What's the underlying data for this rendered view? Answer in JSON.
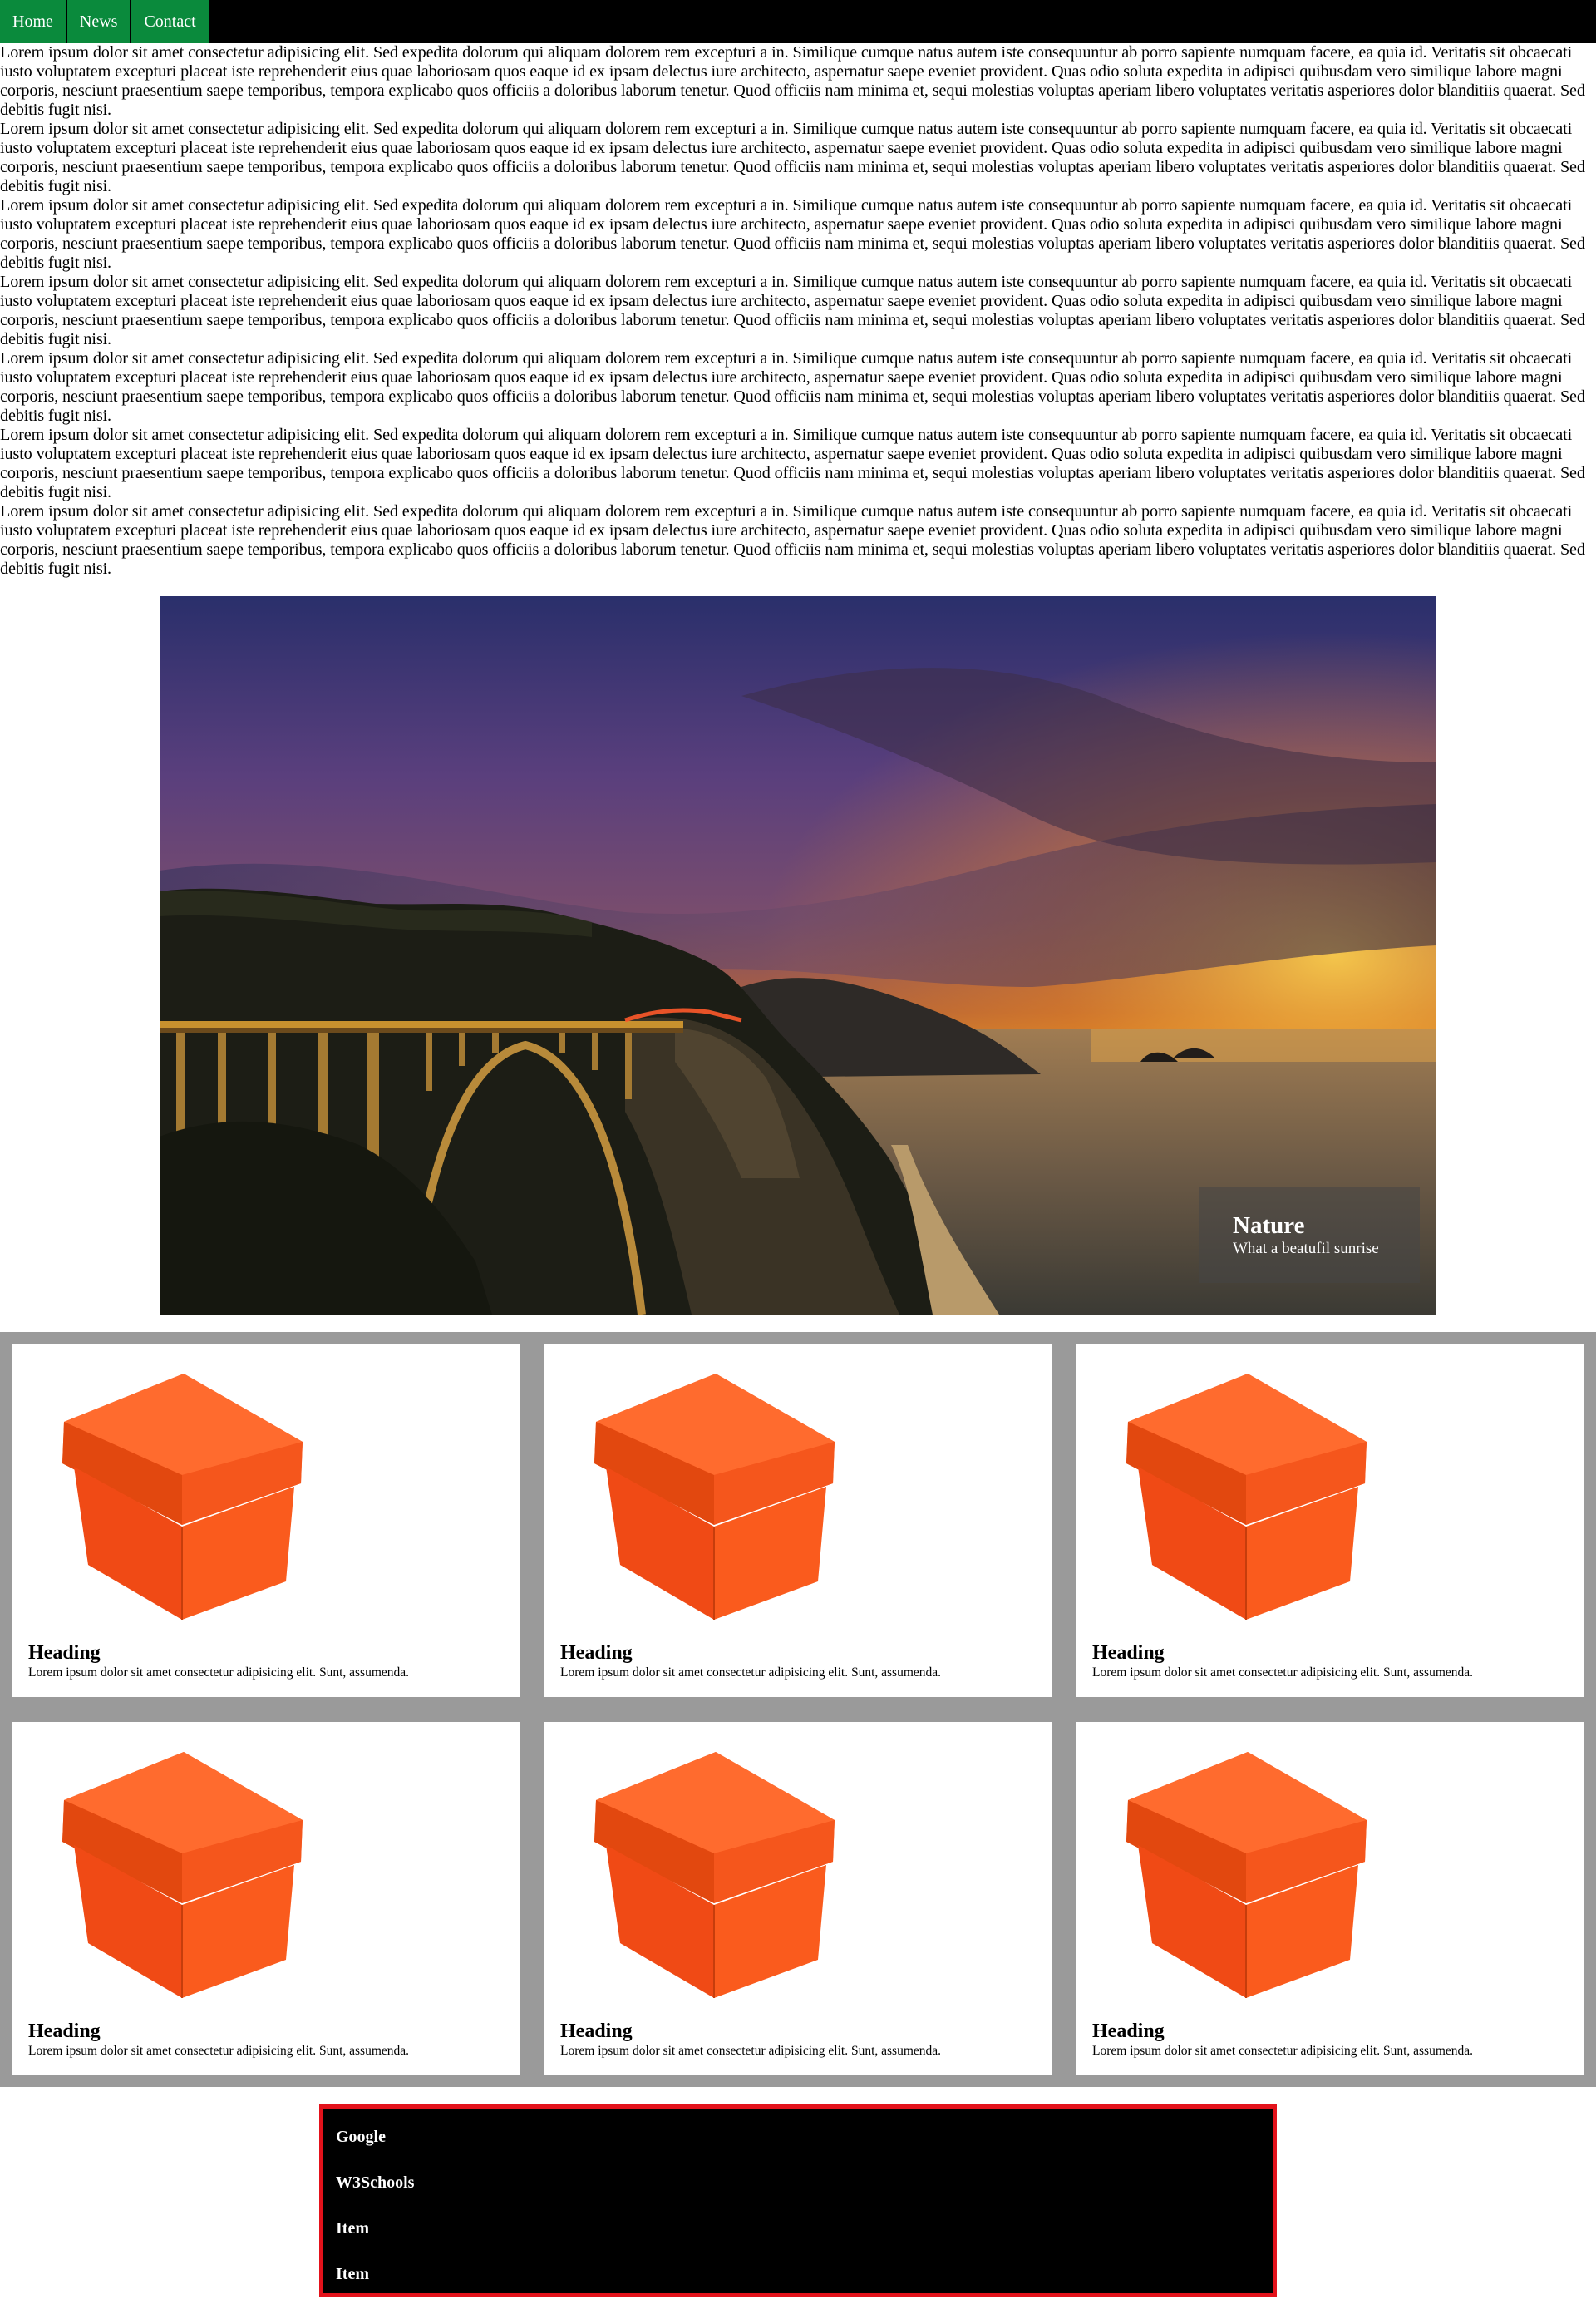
{
  "nav": {
    "items": [
      {
        "label": "Home"
      },
      {
        "label": "News"
      },
      {
        "label": "Contact"
      }
    ]
  },
  "paragraphs": [
    "Lorem ipsum dolor sit amet consectetur adipisicing elit. Sed expedita dolorum qui aliquam dolorem rem excepturi a in. Similique cumque natus autem iste consequuntur ab porro sapiente numquam facere, ea quia id. Veritatis sit obcaecati iusto voluptatem excepturi placeat iste reprehenderit eius quae laboriosam quos eaque id ex ipsam delectus iure architecto, aspernatur saepe eveniet provident. Quas odio soluta expedita in adipisci quibusdam vero similique labore magni corporis, nesciunt praesentium saepe temporibus, tempora explicabo quos officiis a doloribus laborum tenetur. Quod officiis nam minima et, sequi molestias voluptas aperiam libero voluptates veritatis asperiores dolor blanditiis quaerat. Sed debitis fugit nisi.",
    "Lorem ipsum dolor sit amet consectetur adipisicing elit. Sed expedita dolorum qui aliquam dolorem rem excepturi a in. Similique cumque natus autem iste consequuntur ab porro sapiente numquam facere, ea quia id. Veritatis sit obcaecati iusto voluptatem excepturi placeat iste reprehenderit eius quae laboriosam quos eaque id ex ipsam delectus iure architecto, aspernatur saepe eveniet provident. Quas odio soluta expedita in adipisci quibusdam vero similique labore magni corporis, nesciunt praesentium saepe temporibus, tempora explicabo quos officiis a doloribus laborum tenetur. Quod officiis nam minima et, sequi molestias voluptas aperiam libero voluptates veritatis asperiores dolor blanditiis quaerat. Sed debitis fugit nisi.",
    "Lorem ipsum dolor sit amet consectetur adipisicing elit. Sed expedita dolorum qui aliquam dolorem rem excepturi a in. Similique cumque natus autem iste consequuntur ab porro sapiente numquam facere, ea quia id. Veritatis sit obcaecati iusto voluptatem excepturi placeat iste reprehenderit eius quae laboriosam quos eaque id ex ipsam delectus iure architecto, aspernatur saepe eveniet provident. Quas odio soluta expedita in adipisci quibusdam vero similique labore magni corporis, nesciunt praesentium saepe temporibus, tempora explicabo quos officiis a doloribus laborum tenetur. Quod officiis nam minima et, sequi molestias voluptas aperiam libero voluptates veritatis asperiores dolor blanditiis quaerat. Sed debitis fugit nisi.",
    "Lorem ipsum dolor sit amet consectetur adipisicing elit. Sed expedita dolorum qui aliquam dolorem rem excepturi a in. Similique cumque natus autem iste consequuntur ab porro sapiente numquam facere, ea quia id. Veritatis sit obcaecati iusto voluptatem excepturi placeat iste reprehenderit eius quae laboriosam quos eaque id ex ipsam delectus iure architecto, aspernatur saepe eveniet provident. Quas odio soluta expedita in adipisci quibusdam vero similique labore magni corporis, nesciunt praesentium saepe temporibus, tempora explicabo quos officiis a doloribus laborum tenetur. Quod officiis nam minima et, sequi molestias voluptas aperiam libero voluptates veritatis asperiores dolor blanditiis quaerat. Sed debitis fugit nisi.",
    "Lorem ipsum dolor sit amet consectetur adipisicing elit. Sed expedita dolorum qui aliquam dolorem rem excepturi a in. Similique cumque natus autem iste consequuntur ab porro sapiente numquam facere, ea quia id. Veritatis sit obcaecati iusto voluptatem excepturi placeat iste reprehenderit eius quae laboriosam quos eaque id ex ipsam delectus iure architecto, aspernatur saepe eveniet provident. Quas odio soluta expedita in adipisci quibusdam vero similique labore magni corporis, nesciunt praesentium saepe temporibus, tempora explicabo quos officiis a doloribus laborum tenetur. Quod officiis nam minima et, sequi molestias voluptas aperiam libero voluptates veritatis asperiores dolor blanditiis quaerat. Sed debitis fugit nisi.",
    "Lorem ipsum dolor sit amet consectetur adipisicing elit. Sed expedita dolorum qui aliquam dolorem rem excepturi a in. Similique cumque natus autem iste consequuntur ab porro sapiente numquam facere, ea quia id. Veritatis sit obcaecati iusto voluptatem excepturi placeat iste reprehenderit eius quae laboriosam quos eaque id ex ipsam delectus iure architecto, aspernatur saepe eveniet provident. Quas odio soluta expedita in adipisci quibusdam vero similique labore magni corporis, nesciunt praesentium saepe temporibus, tempora explicabo quos officiis a doloribus laborum tenetur. Quod officiis nam minima et, sequi molestias voluptas aperiam libero voluptates veritatis asperiores dolor blanditiis quaerat. Sed debitis fugit nisi.",
    "Lorem ipsum dolor sit amet consectetur adipisicing elit. Sed expedita dolorum qui aliquam dolorem rem excepturi a in. Similique cumque natus autem iste consequuntur ab porro sapiente numquam facere, ea quia id. Veritatis sit obcaecati iusto voluptatem excepturi placeat iste reprehenderit eius quae laboriosam quos eaque id ex ipsam delectus iure architecto, aspernatur saepe eveniet provident. Quas odio soluta expedita in adipisci quibusdam vero similique labore magni corporis, nesciunt praesentium saepe temporibus, tempora explicabo quos officiis a doloribus laborum tenetur. Quod officiis nam minima et, sequi molestias voluptas aperiam libero voluptates veritatis asperiores dolor blanditiis quaerat. Sed debitis fugit nisi."
  ],
  "hero": {
    "caption_title": "Nature",
    "caption_subtitle": "What a beatufil sunrise"
  },
  "cards": [
    {
      "heading": "Heading",
      "text": "Lorem ipsum dolor sit amet consectetur adipisicing elit. Sunt, assumenda."
    },
    {
      "heading": "Heading",
      "text": "Lorem ipsum dolor sit amet consectetur adipisicing elit. Sunt, assumenda."
    },
    {
      "heading": "Heading",
      "text": "Lorem ipsum dolor sit amet consectetur adipisicing elit. Sunt, assumenda."
    },
    {
      "heading": "Heading",
      "text": "Lorem ipsum dolor sit amet consectetur adipisicing elit. Sunt, assumenda."
    },
    {
      "heading": "Heading",
      "text": "Lorem ipsum dolor sit amet consectetur adipisicing elit. Sunt, assumenda."
    },
    {
      "heading": "Heading",
      "text": "Lorem ipsum dolor sit amet consectetur adipisicing elit. Sunt, assumenda."
    }
  ],
  "links": {
    "items": [
      {
        "label": "Google"
      },
      {
        "label": "W3Schools"
      },
      {
        "label": "Item"
      },
      {
        "label": "Item"
      }
    ]
  },
  "colors": {
    "nav_bg": "#000000",
    "nav_item_bg": "#0a8a3c",
    "grid_bg": "#9a9a9a",
    "list_border": "#e3121b",
    "box_orange": "#f24e18"
  }
}
